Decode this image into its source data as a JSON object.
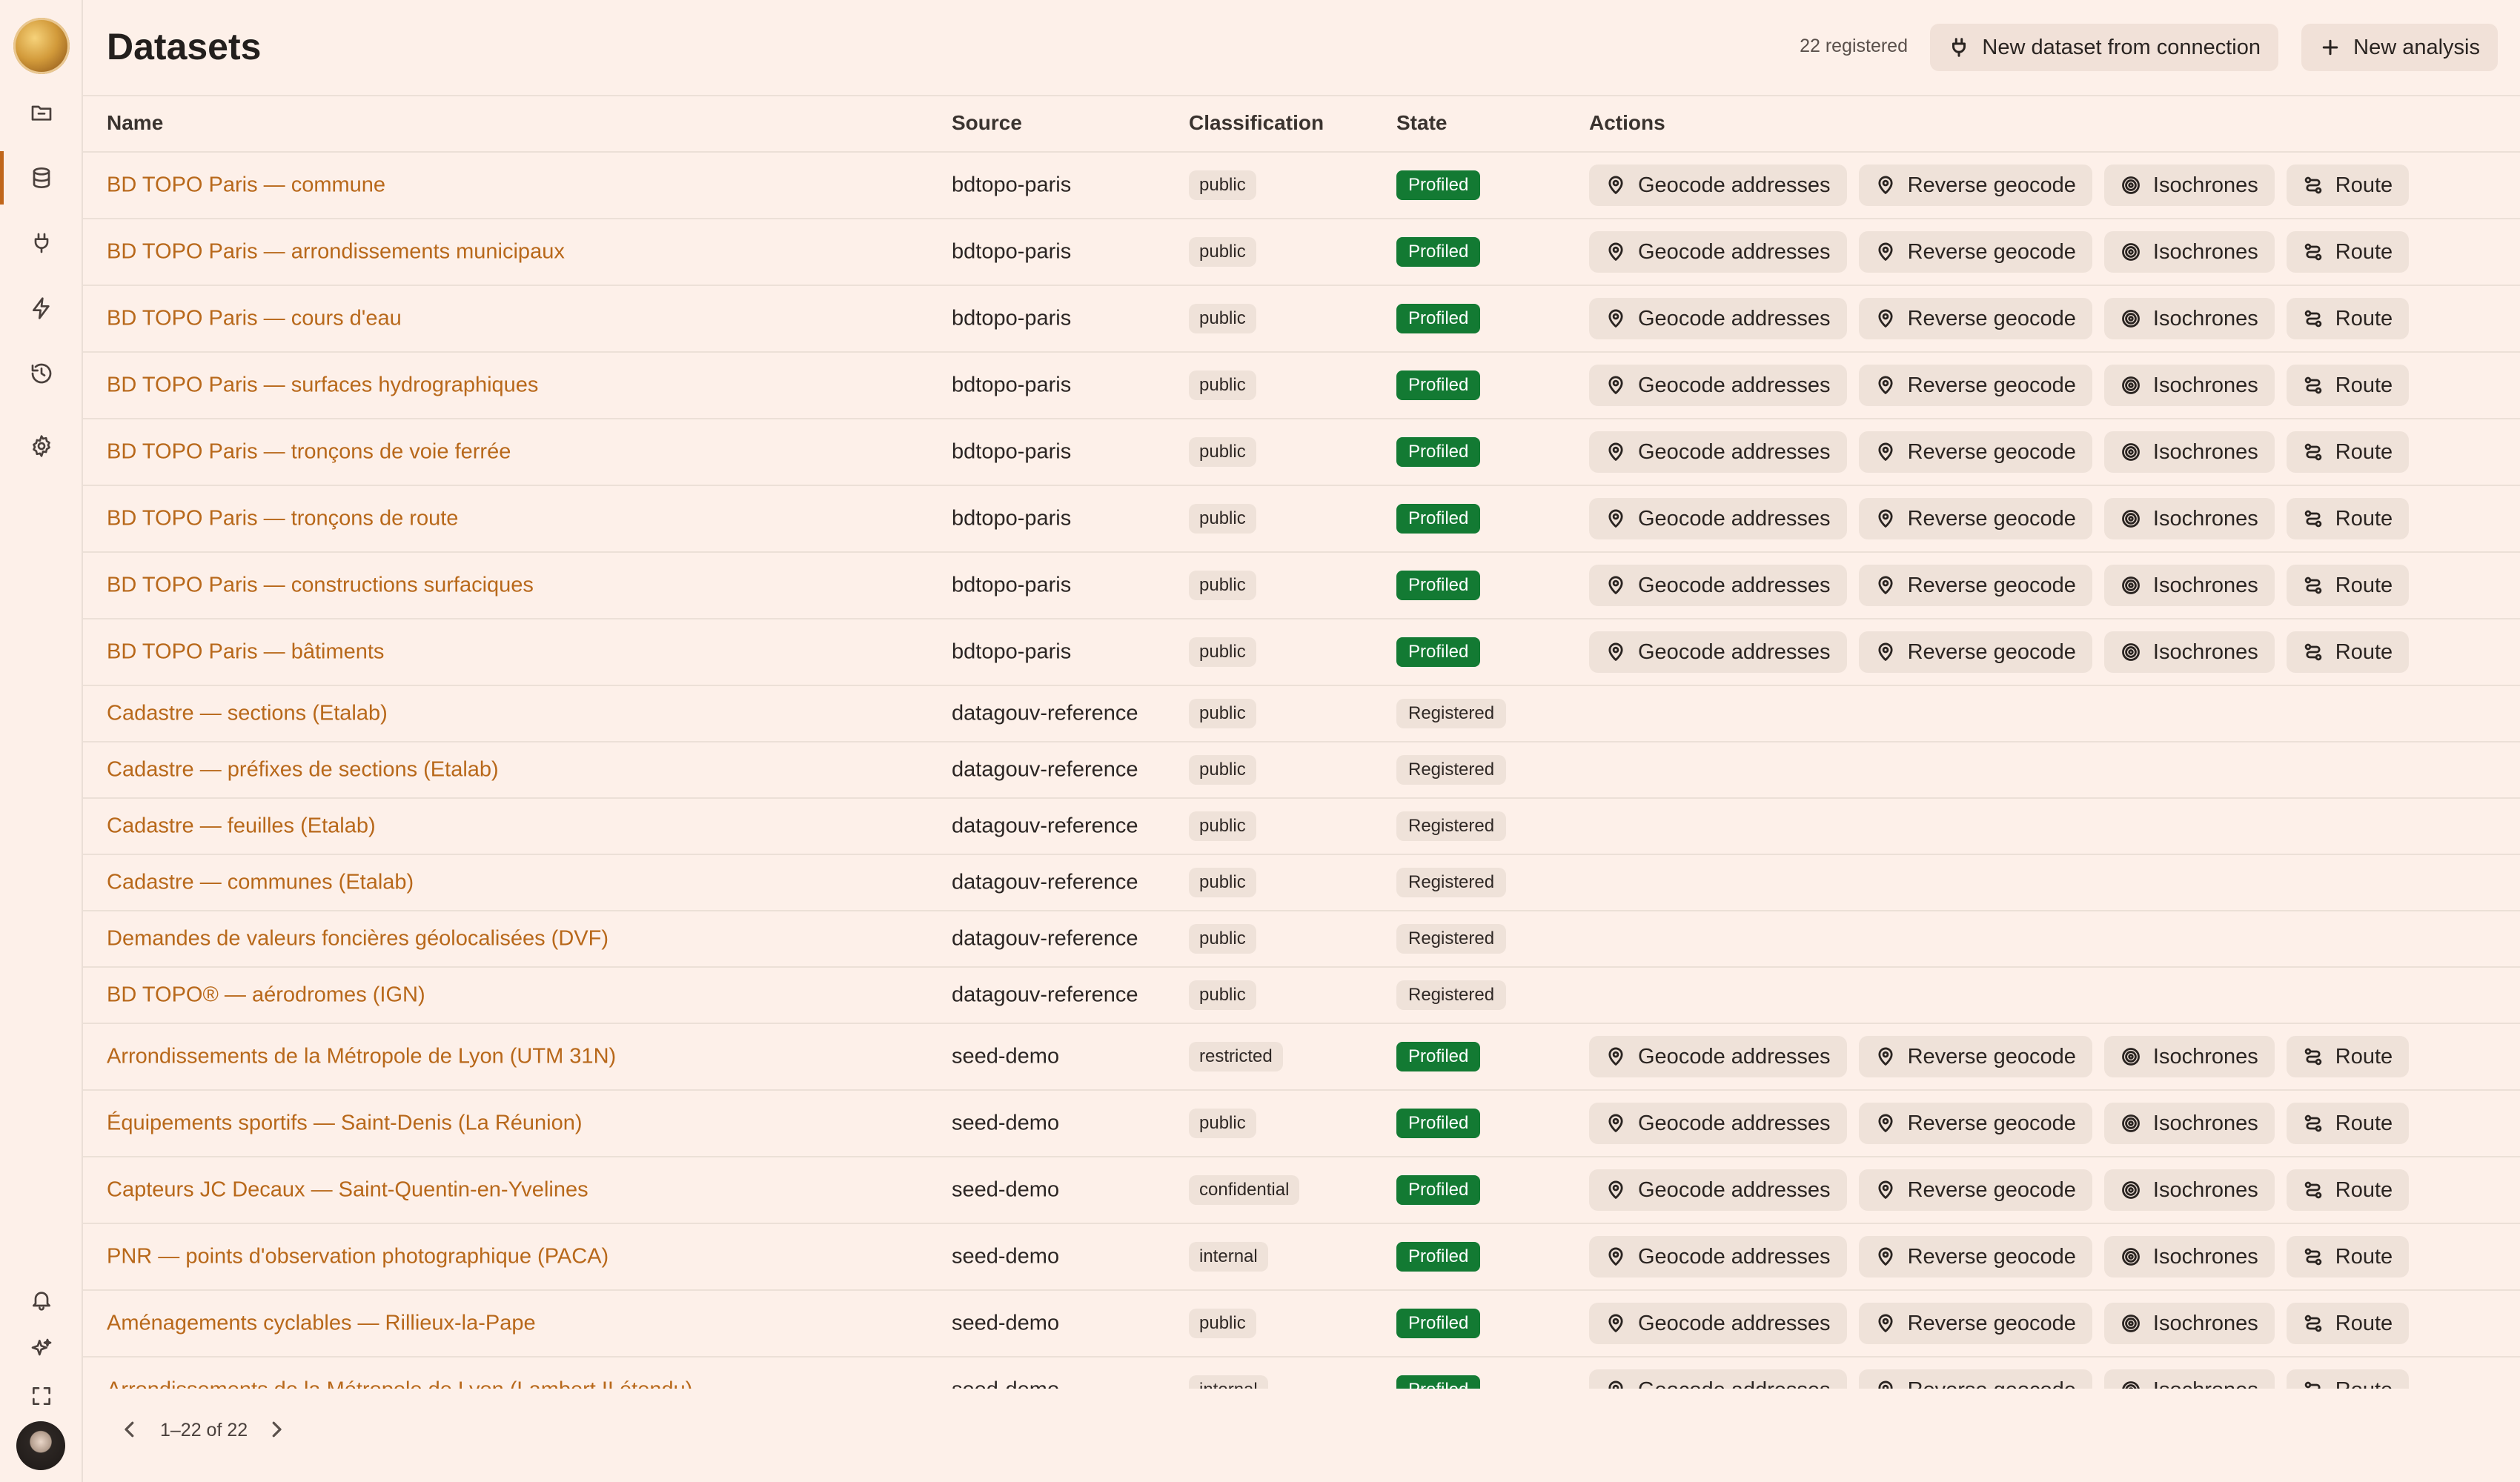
{
  "header": {
    "title": "Datasets",
    "count": "22 registered",
    "new_connection_label": "New dataset from connection",
    "new_analysis_label": "New analysis"
  },
  "sidebar": {
    "items": [
      {
        "name": "folder",
        "icon": "folder-icon"
      },
      {
        "name": "datasets",
        "icon": "database-icon",
        "active": true
      },
      {
        "name": "connections",
        "icon": "plug-icon"
      },
      {
        "name": "jobs",
        "icon": "lightning-icon"
      },
      {
        "name": "history",
        "icon": "history-icon"
      },
      {
        "name": "settings",
        "icon": "gear-icon"
      }
    ],
    "bottom_items": [
      {
        "name": "notifications",
        "icon": "bell-icon"
      },
      {
        "name": "ai",
        "icon": "sparkle-icon"
      },
      {
        "name": "fullscreen",
        "icon": "expand-icon"
      }
    ]
  },
  "table": {
    "columns": [
      "Name",
      "Source",
      "Classification",
      "State",
      "Actions"
    ],
    "action_labels": [
      "Geocode addresses",
      "Reverse geocode",
      "Isochrones",
      "Route"
    ],
    "rows": [
      {
        "name": "BD TOPO Paris — commune",
        "source": "bdtopo-paris",
        "classification": "public",
        "state": "Profiled"
      },
      {
        "name": "BD TOPO Paris — arrondissements municipaux",
        "source": "bdtopo-paris",
        "classification": "public",
        "state": "Profiled"
      },
      {
        "name": "BD TOPO Paris — cours d'eau",
        "source": "bdtopo-paris",
        "classification": "public",
        "state": "Profiled"
      },
      {
        "name": "BD TOPO Paris — surfaces hydrographiques",
        "source": "bdtopo-paris",
        "classification": "public",
        "state": "Profiled"
      },
      {
        "name": "BD TOPO Paris — tronçons de voie ferrée",
        "source": "bdtopo-paris",
        "classification": "public",
        "state": "Profiled"
      },
      {
        "name": "BD TOPO Paris — tronçons de route",
        "source": "bdtopo-paris",
        "classification": "public",
        "state": "Profiled"
      },
      {
        "name": "BD TOPO Paris — constructions surfaciques",
        "source": "bdtopo-paris",
        "classification": "public",
        "state": "Profiled"
      },
      {
        "name": "BD TOPO Paris — bâtiments",
        "source": "bdtopo-paris",
        "classification": "public",
        "state": "Profiled"
      },
      {
        "name": "Cadastre — sections (Etalab)",
        "source": "datagouv-reference",
        "classification": "public",
        "state": "Registered"
      },
      {
        "name": "Cadastre — préfixes de sections (Etalab)",
        "source": "datagouv-reference",
        "classification": "public",
        "state": "Registered"
      },
      {
        "name": "Cadastre — feuilles (Etalab)",
        "source": "datagouv-reference",
        "classification": "public",
        "state": "Registered"
      },
      {
        "name": "Cadastre — communes (Etalab)",
        "source": "datagouv-reference",
        "classification": "public",
        "state": "Registered"
      },
      {
        "name": "Demandes de valeurs foncières géolocalisées (DVF)",
        "source": "datagouv-reference",
        "classification": "public",
        "state": "Registered"
      },
      {
        "name": "BD TOPO® — aérodromes (IGN)",
        "source": "datagouv-reference",
        "classification": "public",
        "state": "Registered"
      },
      {
        "name": "Arrondissements de la Métropole de Lyon (UTM 31N)",
        "source": "seed-demo",
        "classification": "restricted",
        "state": "Profiled"
      },
      {
        "name": "Équipements sportifs — Saint-Denis (La Réunion)",
        "source": "seed-demo",
        "classification": "public",
        "state": "Profiled"
      },
      {
        "name": "Capteurs JC Decaux — Saint-Quentin-en-Yvelines",
        "source": "seed-demo",
        "classification": "confidential",
        "state": "Profiled"
      },
      {
        "name": "PNR — points d'observation photographique (PACA)",
        "source": "seed-demo",
        "classification": "internal",
        "state": "Profiled"
      },
      {
        "name": "Aménagements cyclables — Rillieux-la-Pape",
        "source": "seed-demo",
        "classification": "public",
        "state": "Profiled"
      },
      {
        "name": "Arrondissements de la Métropole de Lyon (Lambert II étendu)",
        "source": "seed-demo",
        "classification": "internal",
        "state": "Profiled"
      }
    ]
  },
  "pagination": {
    "range": "1–22 of 22"
  },
  "colors": {
    "background": "#fdf0e9",
    "accent": "#b8681a",
    "profiled": "#137a33",
    "chip": "#efe2d9"
  }
}
